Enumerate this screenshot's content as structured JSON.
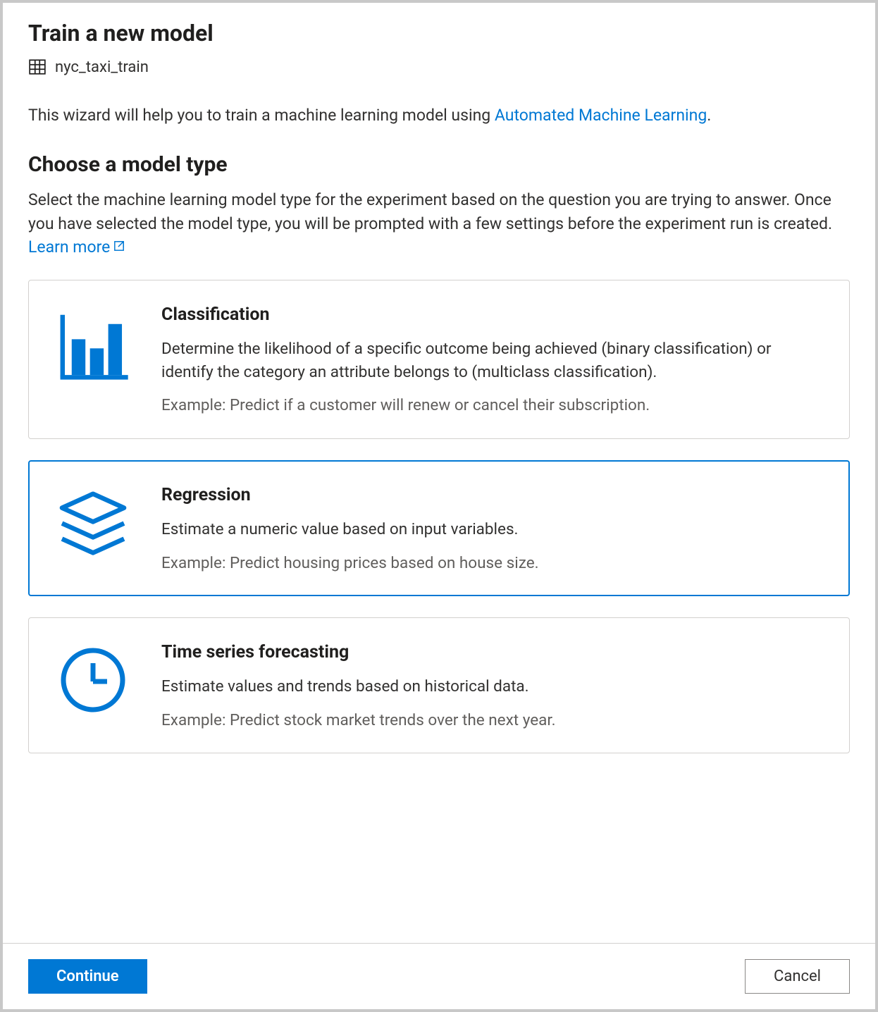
{
  "header": {
    "title": "Train a new model",
    "dataset_name": "nyc_taxi_train"
  },
  "intro": {
    "prefix": "This wizard will help you to train a machine learning model using ",
    "link_text": "Automated Machine Learning",
    "suffix": "."
  },
  "section": {
    "heading": "Choose a model type",
    "description_prefix": "Select the machine learning model type for the experiment based on the question you are trying to answer. Once you have selected the model type, you will be prompted with a few settings before the experiment run is created. ",
    "learn_more": "Learn more"
  },
  "cards": [
    {
      "title": "Classification",
      "description": "Determine the likelihood of a specific outcome being achieved (binary classification) or identify the category an attribute belongs to (multiclass classification).",
      "example": "Example: Predict if a customer will renew or cancel their subscription.",
      "selected": false
    },
    {
      "title": "Regression",
      "description": "Estimate a numeric value based on input variables.",
      "example": "Example: Predict housing prices based on house size.",
      "selected": true
    },
    {
      "title": "Time series forecasting",
      "description": "Estimate values and trends based on historical data.",
      "example": "Example: Predict stock market trends over the next year.",
      "selected": false
    }
  ],
  "footer": {
    "continue_label": "Continue",
    "cancel_label": "Cancel"
  }
}
